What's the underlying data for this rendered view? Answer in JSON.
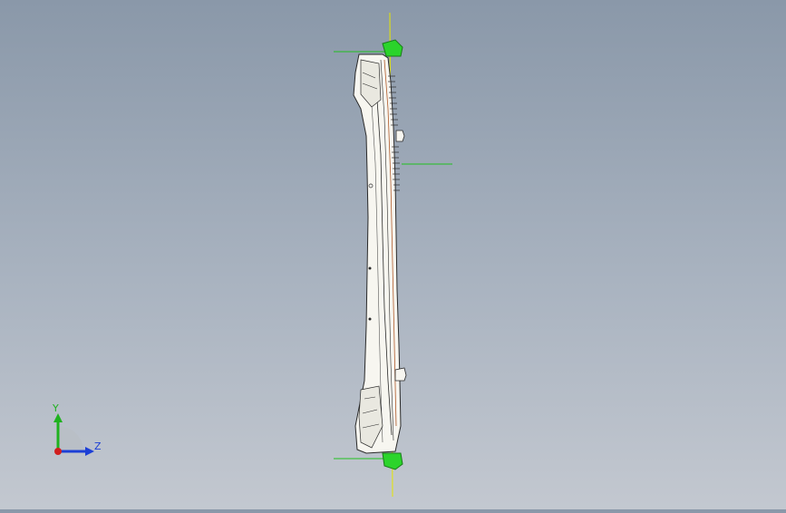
{
  "view": {
    "background_top": "#8a98a9",
    "background_bottom": "#c3c8d0"
  },
  "triad": {
    "y_label": "Y",
    "z_label": "Z",
    "y_color": "#1fb21f",
    "z_color": "#1c3fd6",
    "x_color": "#d11f1f"
  },
  "model": {
    "body_color": "#f7f6f0",
    "edge_color": "#2a2a2a",
    "end_cap_color": "#2bd42b",
    "reference_line_color": "#20c020",
    "axis_line_color": "#e6e600",
    "accent_color": "#b05a2a"
  }
}
